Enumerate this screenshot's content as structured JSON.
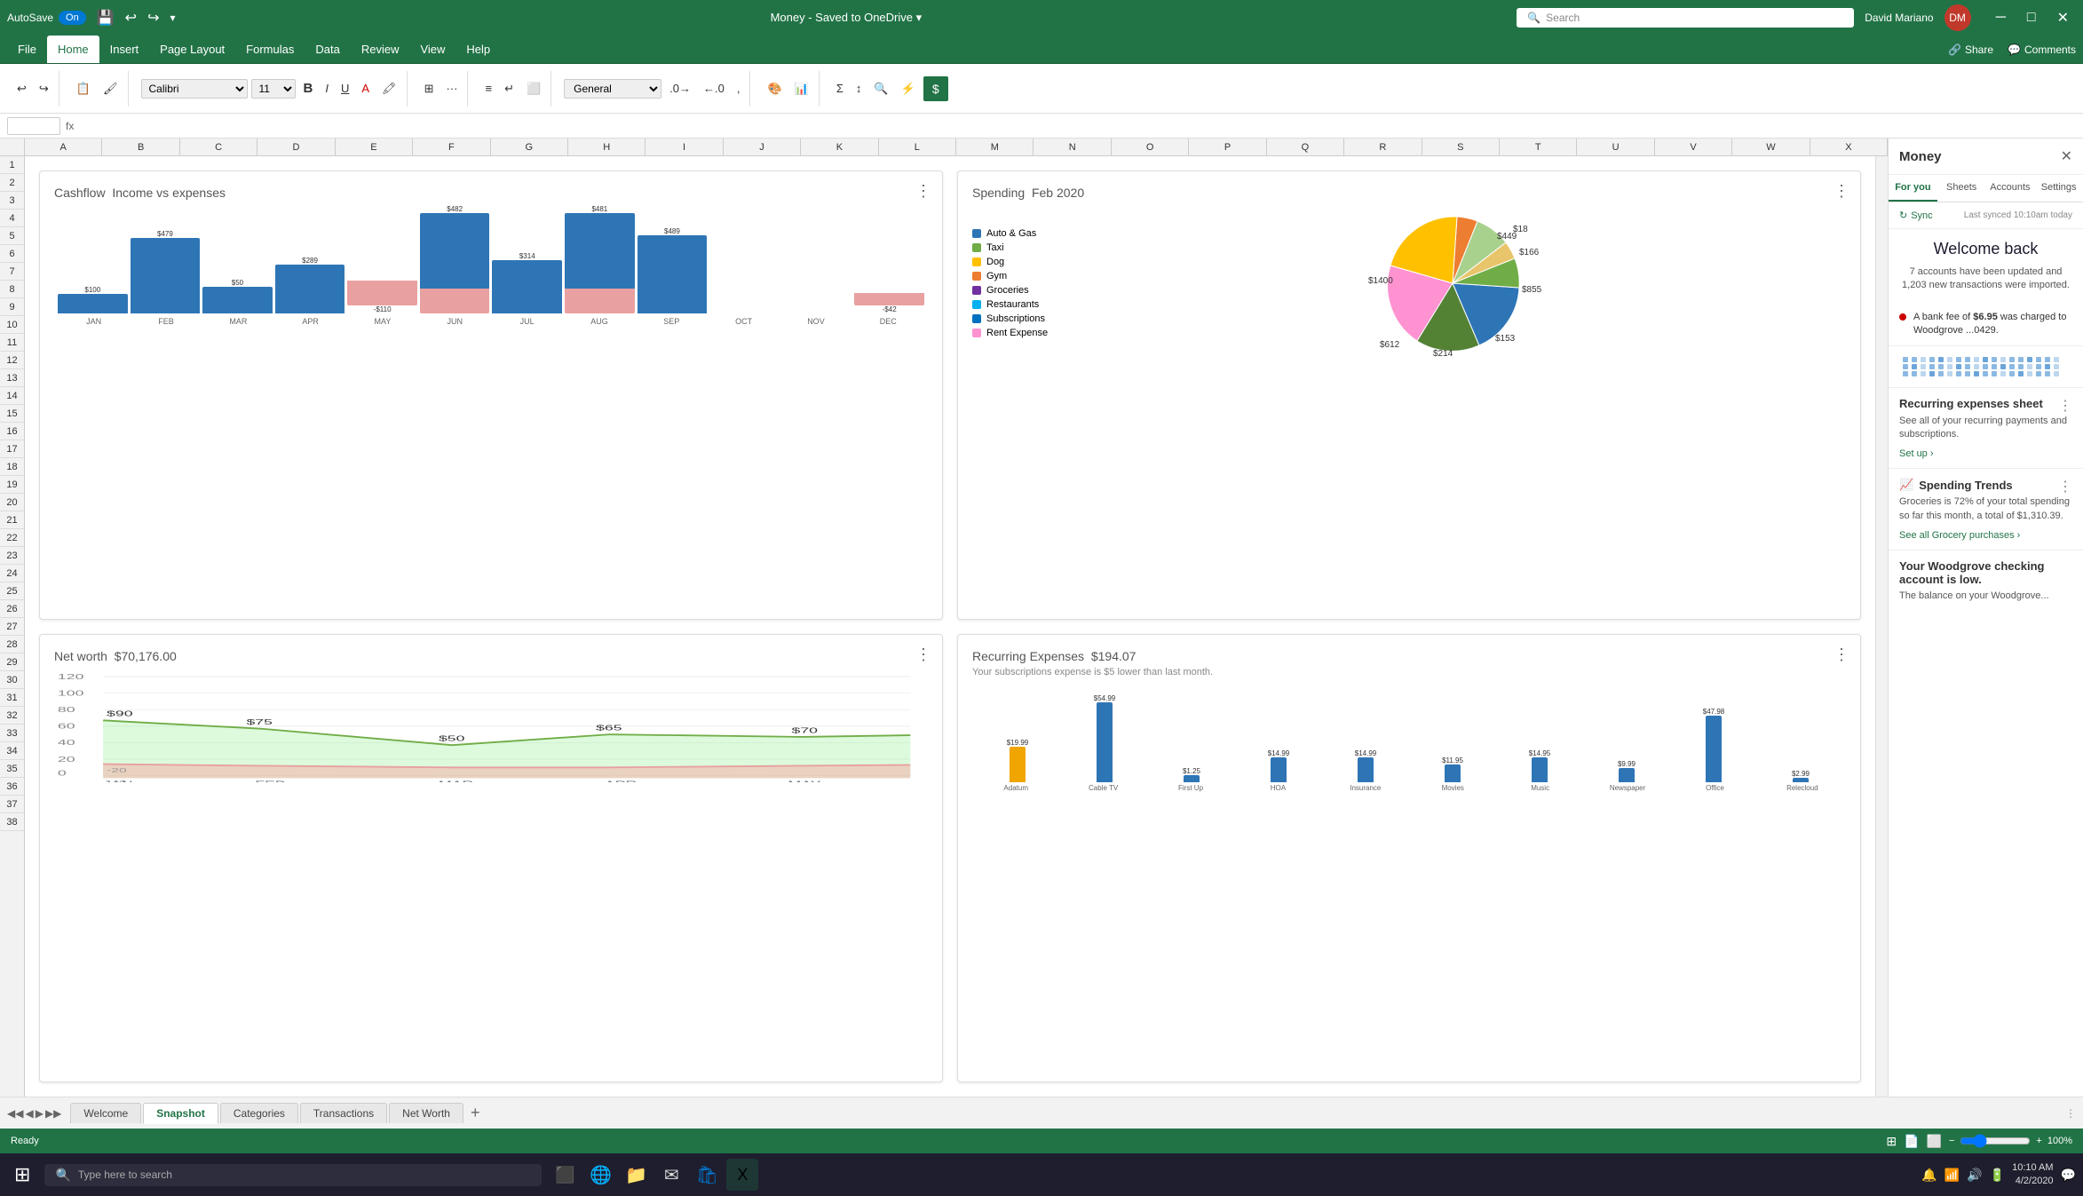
{
  "titlebar": {
    "autosave_label": "AutoSave",
    "toggle_state": "On",
    "file_title": "Money - Saved to OneDrive",
    "search_placeholder": "Search",
    "user_name": "David Mariano",
    "min_btn": "🗕",
    "max_btn": "🗗",
    "close_btn": "✕"
  },
  "ribbon": {
    "tabs": [
      "File",
      "Home",
      "Insert",
      "Page Layout",
      "Formulas",
      "Data",
      "Review",
      "View",
      "Help"
    ],
    "active_tab": "Home",
    "share_label": "Share",
    "comments_label": "Comments"
  },
  "toolbar": {
    "font_name": "Calibri",
    "font_size": "11",
    "format": "General",
    "bold_label": "B"
  },
  "formula_bar": {
    "cell_ref": "",
    "fx_label": "fx"
  },
  "columns": [
    "A",
    "B",
    "C",
    "D",
    "E",
    "F",
    "G",
    "H",
    "I",
    "J",
    "K",
    "L",
    "M",
    "N",
    "O",
    "P",
    "Q",
    "R",
    "S",
    "T",
    "U",
    "V",
    "W",
    "X"
  ],
  "rows": [
    1,
    2,
    3,
    4,
    5,
    6,
    7,
    8,
    9,
    10,
    11,
    12,
    13,
    14,
    15,
    16,
    17,
    18,
    19,
    20,
    21,
    22,
    23,
    24,
    25,
    26,
    27,
    28,
    29,
    30,
    31,
    32,
    33,
    34,
    35,
    36,
    37,
    38
  ],
  "cashflow": {
    "title": "Cashflow",
    "subtitle": "Income vs expenses",
    "months": [
      "JAN",
      "FEB",
      "MAR",
      "APR",
      "MAY",
      "JUN",
      "JUL",
      "AUG",
      "SEP",
      "OCT",
      "NOV",
      "DEC"
    ],
    "income": [
      100,
      479,
      50,
      289,
      null,
      482,
      314,
      481,
      489,
      null,
      null,
      null
    ],
    "expenses": [
      null,
      null,
      null,
      null,
      -110,
      -110,
      null,
      -110,
      null,
      null,
      null,
      -42
    ],
    "income_values": [
      "$100",
      "$479",
      "$50",
      "$289",
      "",
      "$482",
      "$314",
      "$481",
      "$489",
      "",
      "",
      ""
    ],
    "expense_values": [
      "",
      "",
      "",
      "",
      "$-110",
      "$-110",
      "",
      "$-110",
      "",
      "",
      "",
      "$-42"
    ],
    "bar_heights_income": [
      20,
      80,
      30,
      50,
      0,
      82,
      60,
      80,
      85,
      0,
      0,
      0
    ],
    "bar_heights_expense": [
      0,
      0,
      0,
      0,
      30,
      30,
      0,
      28,
      0,
      0,
      0,
      12
    ]
  },
  "spending": {
    "title": "Spending",
    "subtitle": "Feb 2020",
    "legend": [
      {
        "label": "Auto & Gas",
        "color": "#2e75b6"
      },
      {
        "label": "Taxi",
        "color": "#70ad47"
      },
      {
        "label": "Dog",
        "color": "#ffc000"
      },
      {
        "label": "Gym",
        "color": "#ed7d31"
      },
      {
        "label": "Groceries",
        "color": "#7030a0"
      },
      {
        "label": "Restaurants",
        "color": "#00b0f0"
      },
      {
        "label": "Subscriptions",
        "color": "#0070c0"
      },
      {
        "label": "Rent Expense",
        "color": "#ff92d0"
      }
    ],
    "pie_values": [
      {
        "label": "$449",
        "value": 449,
        "color": "#e8c56a"
      },
      {
        "label": "$18",
        "value": 18,
        "color": "#e0a0c8"
      },
      {
        "label": "$166",
        "value": 166,
        "color": "#a9d18e"
      },
      {
        "label": "$855",
        "value": 855,
        "color": "#ffc000"
      },
      {
        "label": "$153",
        "value": 153,
        "color": "#548235"
      },
      {
        "label": "$214",
        "value": 214,
        "color": "#2e75b6"
      },
      {
        "label": "$612",
        "value": 612,
        "color": "#70ad47"
      },
      {
        "label": "$1400",
        "value": 1400,
        "color": "#ff92d0"
      }
    ]
  },
  "networth": {
    "title": "Net worth",
    "amount": "$70,176.00",
    "months": [
      "JAN",
      "FEB",
      "MAR",
      "APR",
      "MAY"
    ],
    "points": [
      90,
      75,
      50,
      65,
      70
    ],
    "point_labels": [
      "$90",
      "$75",
      "$50",
      "$65",
      "$70"
    ]
  },
  "recurring": {
    "title": "Recurring Expenses",
    "amount": "$194.07",
    "subtitle": "Your subscriptions expense is $5 lower than last month.",
    "categories": [
      "Adatum",
      "Cable TV",
      "First Up",
      "HOA",
      "Insurance",
      "Movies",
      "Music",
      "Newspaper",
      "Office",
      "Relecloud"
    ],
    "gold_values": [
      19.99,
      null,
      null,
      null,
      null,
      null,
      null,
      null,
      null,
      null
    ],
    "blue_values": [
      null,
      54.99,
      1.25,
      14.99,
      14.99,
      11.95,
      14.95,
      9.99,
      47.98,
      2.99
    ],
    "gold_labels": [
      "$19.99",
      "",
      "",
      "",
      "",
      "",
      "",
      "",
      "",
      ""
    ],
    "blue_labels": [
      "",
      "$54.99",
      "$1.25",
      "$14.99",
      "$14.99",
      "$11.95",
      "$14.95",
      "$9.99",
      "$47.98",
      "$2.99"
    ],
    "bar_heights_gold": [
      40,
      0,
      0,
      0,
      0,
      0,
      0,
      0,
      0,
      0
    ],
    "bar_heights_blue": [
      0,
      90,
      8,
      28,
      28,
      20,
      28,
      16,
      80,
      4
    ]
  },
  "side_panel": {
    "title": "Money",
    "close_label": "✕",
    "tabs": [
      "For you",
      "Sheets",
      "Accounts",
      "Settings"
    ],
    "active_tab": "For you",
    "sync_label": "Sync",
    "sync_time": "Last synced 10:10am today",
    "welcome_title": "Welcome back",
    "welcome_text": "7 accounts have been updated and 1,203 new transactions were imported.",
    "alert_text": "A bank fee of $6.95 was charged to Woodgrove ...0429.",
    "recurring_section_title": "Recurring expenses sheet",
    "recurring_section_text": "See all of your recurring payments and subscriptions.",
    "setup_label": "Set up ›",
    "trends_title": "Spending Trends",
    "trends_text": "Groceries is 72% of your total spending so far this month, a total of $1,310.39.",
    "see_grocery_label": "See all Grocery purchases ›",
    "woodgrove_title": "Your Woodgrove checking account is low.",
    "woodgrove_text": "The balance on your Woodgrove..."
  },
  "sheet_tabs": {
    "tabs": [
      "Welcome",
      "Snapshot",
      "Categories",
      "Transactions",
      "Net Worth"
    ],
    "active_tab": "Snapshot"
  },
  "status_bar": {
    "ready_label": "Ready"
  },
  "taskbar": {
    "search_placeholder": "Type here to search",
    "time": "10:10 AM",
    "date": "4/2/2020"
  }
}
